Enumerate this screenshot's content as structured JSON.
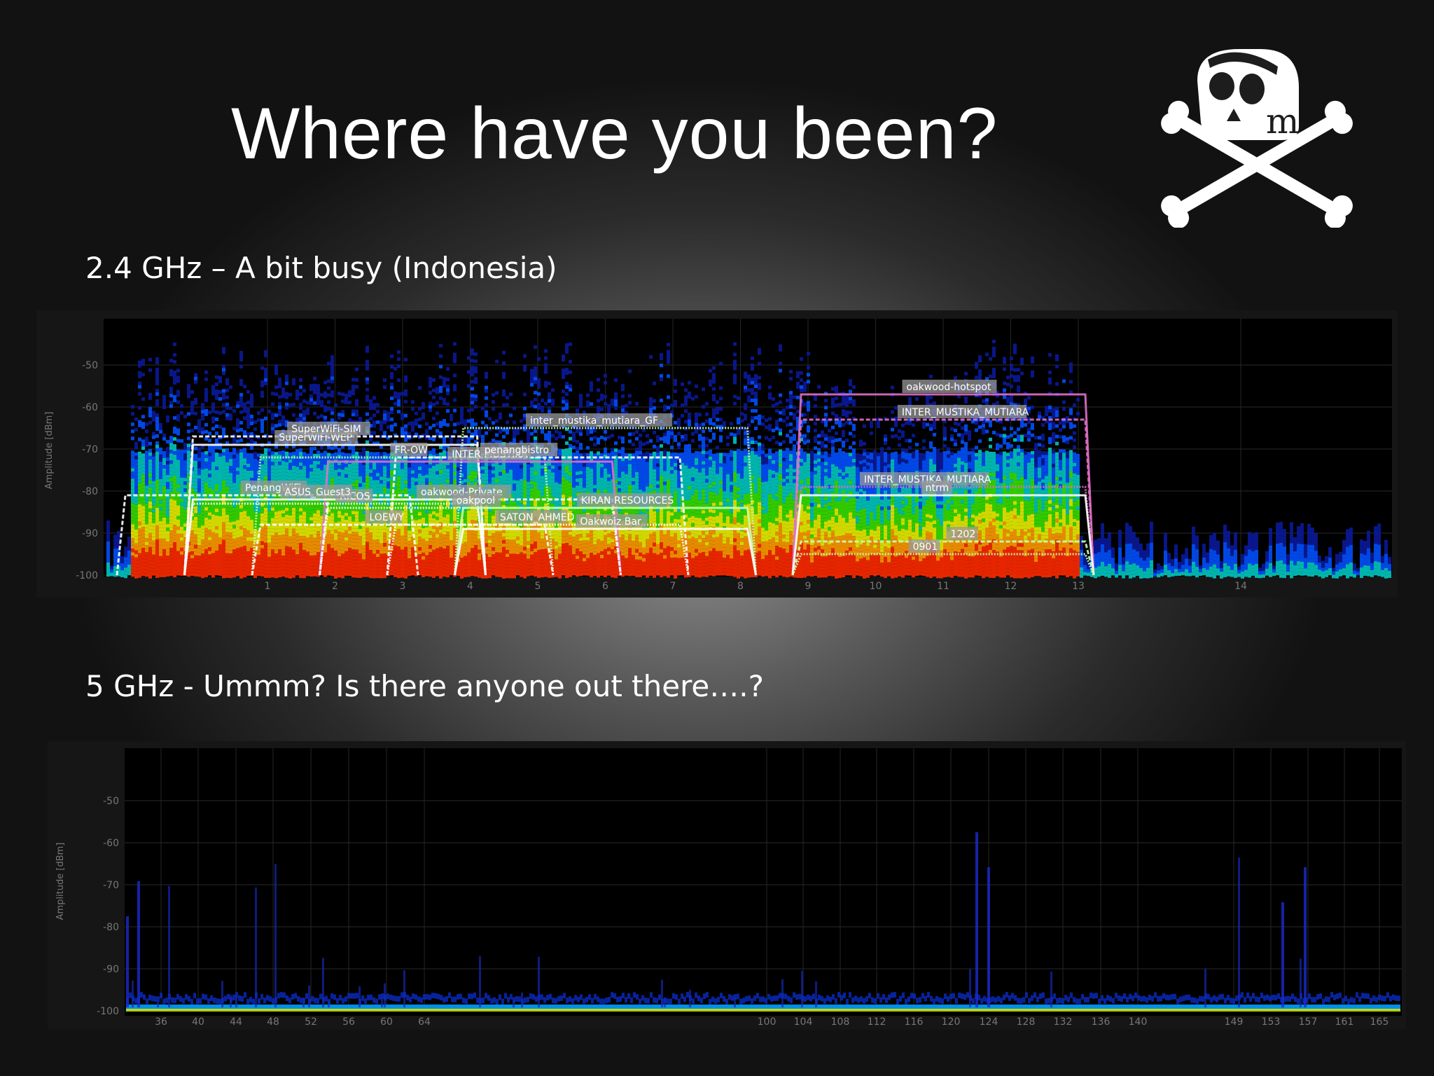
{
  "slide": {
    "title": "Where have you been?",
    "subtitle_24": "2.4 GHz – A bit busy (Indonesia)",
    "subtitle_5": "5 GHz - Ummm?  Is there anyone out there….?",
    "logo_letter": "m"
  },
  "colors": {
    "background": "#2b2b2b",
    "plot_bg": "#000000",
    "label_bg": "#9a9a9a",
    "ssid_white": "#ffffff",
    "ssid_pink": "#e070c8",
    "ssid_green": "#c8ffb0"
  },
  "chart_data": [
    {
      "type": "heatmap",
      "title": "",
      "ylabel": "Amplitude [dBm]",
      "xlabel": "",
      "ylim": [
        -100,
        -45
      ],
      "yticks": [
        "-50",
        "-60",
        "-70",
        "-80",
        "-90",
        "-100"
      ],
      "channels": [
        "1",
        "2",
        "3",
        "4",
        "5",
        "6",
        "7",
        "8",
        "9",
        "10",
        "11",
        "12",
        "13",
        "14"
      ],
      "grid": true,
      "networks": [
        {
          "ssid": "SuperWiFi-WEP",
          "channel": 2,
          "amplitude": -69,
          "color": "white"
        },
        {
          "ssid": "SuperWiFi-SIM",
          "channel": 2,
          "amplitude": -67,
          "color": "white"
        },
        {
          "ssid": "FR-OW",
          "channel": 3,
          "amplitude": -72,
          "color": "green"
        },
        {
          "ssid": "INTER-MUSTIKA",
          "channel": 4,
          "amplitude": -73,
          "color": "pink"
        },
        {
          "ssid": "penangbistro",
          "channel": 5,
          "amplitude": -72,
          "color": "white"
        },
        {
          "ssid": "inter_mustika_mutiara_GF",
          "channel": 6,
          "amplitude": -65,
          "color": "green"
        },
        {
          "ssid": "oakwood-hotspot",
          "channel": 11,
          "amplitude": -57,
          "color": "pink"
        },
        {
          "ssid": "INTER_MUSTIKA_MUTIARA",
          "channel": 11,
          "amplitude": -63,
          "color": "pink"
        },
        {
          "ssid": "INTER_MUSTIKA_MUTIARA",
          "channel": 11,
          "amplitude": -79,
          "color": "pink"
        },
        {
          "ssid": "ntrm",
          "channel": 11,
          "amplitude": -81,
          "color": "white"
        },
        {
          "ssid": "PenangWiFi",
          "channel": 1,
          "amplitude": -81,
          "color": "white"
        },
        {
          "ssid": "RICOS",
          "channel": 2,
          "amplitude": -83,
          "color": "white"
        },
        {
          "ssid": "ASUS_Guest3",
          "channel": 2,
          "amplitude": -82,
          "color": "white"
        },
        {
          "ssid": "oakwood-Private",
          "channel": 4,
          "amplitude": -82,
          "color": "white"
        },
        {
          "ssid": "oakpool",
          "channel": 4,
          "amplitude": -84,
          "color": "white"
        },
        {
          "ssid": "KIRAN RESOURCES",
          "channel": 6,
          "amplitude": -84,
          "color": "green"
        },
        {
          "ssid": "LOEWY",
          "channel": 3,
          "amplitude": -88,
          "color": "white"
        },
        {
          "ssid": "SATON_AHMED",
          "channel": 5,
          "amplitude": -88,
          "color": "white"
        },
        {
          "ssid": "Oakwoiz Bar",
          "channel": 6,
          "amplitude": -89,
          "color": "white"
        },
        {
          "ssid": "1202",
          "channel": 11,
          "amplitude": -92,
          "color": "green"
        },
        {
          "ssid": "0901",
          "channel": 11,
          "amplitude": -95,
          "color": "green"
        }
      ]
    },
    {
      "type": "heatmap",
      "title": "",
      "ylabel": "Amplitude [dBm]",
      "xlabel": "",
      "ylim": [
        -100,
        -45
      ],
      "yticks": [
        "-50",
        "-60",
        "-70",
        "-80",
        "-90",
        "-100"
      ],
      "channels": [
        "36",
        "40",
        "44",
        "48",
        "52",
        "56",
        "60",
        "64",
        "100",
        "104",
        "108",
        "112",
        "116",
        "120",
        "124",
        "128",
        "132",
        "136",
        "140",
        "149",
        "153",
        "157",
        "161",
        "165"
      ],
      "grid": true,
      "networks": []
    }
  ]
}
